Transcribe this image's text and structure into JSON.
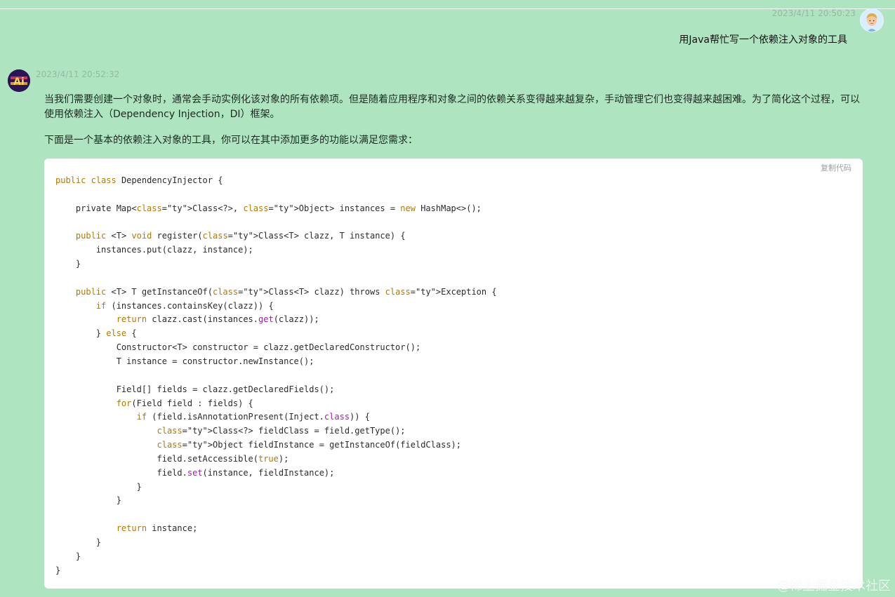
{
  "user": {
    "timestamp": "2023/4/11 20:50:23",
    "message": "用Java帮忙写一个依赖注入对象的工具",
    "avatar_icon": "user-avatar-icon"
  },
  "assistant": {
    "timestamp": "2023/4/11 20:52:32",
    "avatar_text": "Ai",
    "paragraphs": [
      "当我们需要创建一个对象时，通常会手动实例化该对象的所有依赖项。但是随着应用程序和对象之间的依赖关系变得越来越复杂，手动管理它们也变得越来越困难。为了简化这个过程，可以使用依赖注入（Dependency Injection，DI）框架。",
      "下面是一个基本的依赖注入对象的工具，你可以在其中添加更多的功能以满足您需求："
    ],
    "code_block": {
      "copy_label": "复制代码",
      "language": "java",
      "lines": [
        "public class DependencyInjector {",
        "",
        "    private Map<Class<?>, Object> instances = new HashMap<>();",
        "",
        "    public <T> void register(Class<T> clazz, T instance) {",
        "        instances.put(clazz, instance);",
        "    }",
        "",
        "    public <T> T getInstanceOf(Class<T> clazz) throws Exception {",
        "        if (instances.containsKey(clazz)) {",
        "            return clazz.cast(instances.get(clazz));",
        "        } else {",
        "            Constructor<T> constructor = clazz.getDeclaredConstructor();",
        "            T instance = constructor.newInstance();",
        "",
        "            Field[] fields = clazz.getDeclaredFields();",
        "            for(Field field : fields) {",
        "                if (field.isAnnotationPresent(Inject.class)) {",
        "                    Class<?> fieldClass = field.getType();",
        "                    Object fieldInstance = getInstanceOf(fieldClass);",
        "                    field.setAccessible(true);",
        "                    field.set(instance, fieldInstance);",
        "                }",
        "            }",
        "",
        "            return instance;",
        "        }",
        "    }",
        "}"
      ]
    }
  },
  "watermark": "@稀土掘金技术社区",
  "colors": {
    "background": "#aee4c0",
    "keyword": "#b07a00",
    "type": "#a21caf"
  }
}
